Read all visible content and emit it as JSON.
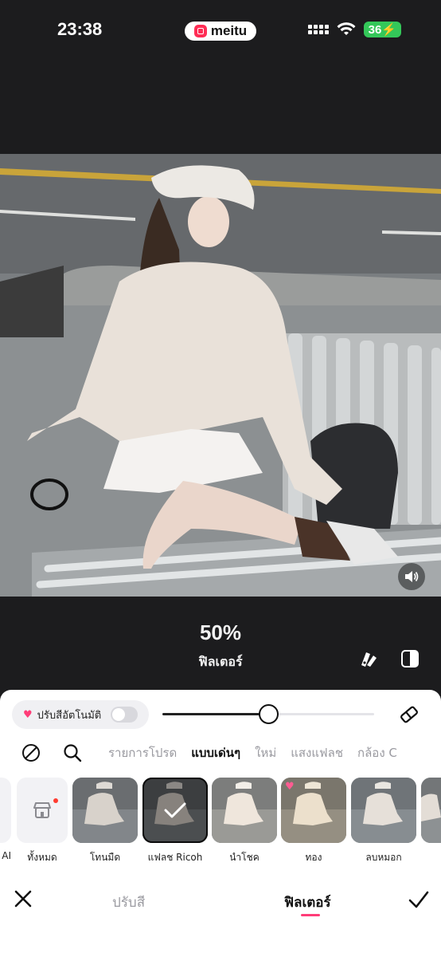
{
  "status_bar": {
    "time": "23:38",
    "app_badge": "meitu",
    "battery": "36"
  },
  "editor": {
    "strength_value": "50%",
    "mode_label": "ฟิลเตอร์",
    "slider_level": 0.5
  },
  "panel": {
    "auto_adjust_label": "ปรับสีอัตโนมัติ",
    "auto_adjust_on": false,
    "categories": [
      "รายการโปรด",
      "แบบเด่นๆ",
      "ใหม่",
      "แสงแฟลช",
      "กล้อง C"
    ],
    "active_category": "แบบเด่นๆ",
    "left_partial_label": "AI",
    "store_label": "ทั้งหมด",
    "filters": [
      {
        "label": "โทนมืด",
        "selected": false,
        "vip": false
      },
      {
        "label": "แฟลช Ricoh",
        "selected": true,
        "vip": false
      },
      {
        "label": "นำโชค",
        "selected": false,
        "vip": false
      },
      {
        "label": "ทอง",
        "selected": false,
        "vip": true
      },
      {
        "label": "ลบหมอก",
        "selected": false,
        "vip": false
      }
    ]
  },
  "bottom_tabs": {
    "adjust_label": "ปรับสี",
    "filter_label": "ฟิลเตอร์",
    "active": "ฟิลเตอร์"
  },
  "colors": {
    "accent": "#ff3c78",
    "background": "#1c1c1e",
    "panel": "#ffffff"
  }
}
